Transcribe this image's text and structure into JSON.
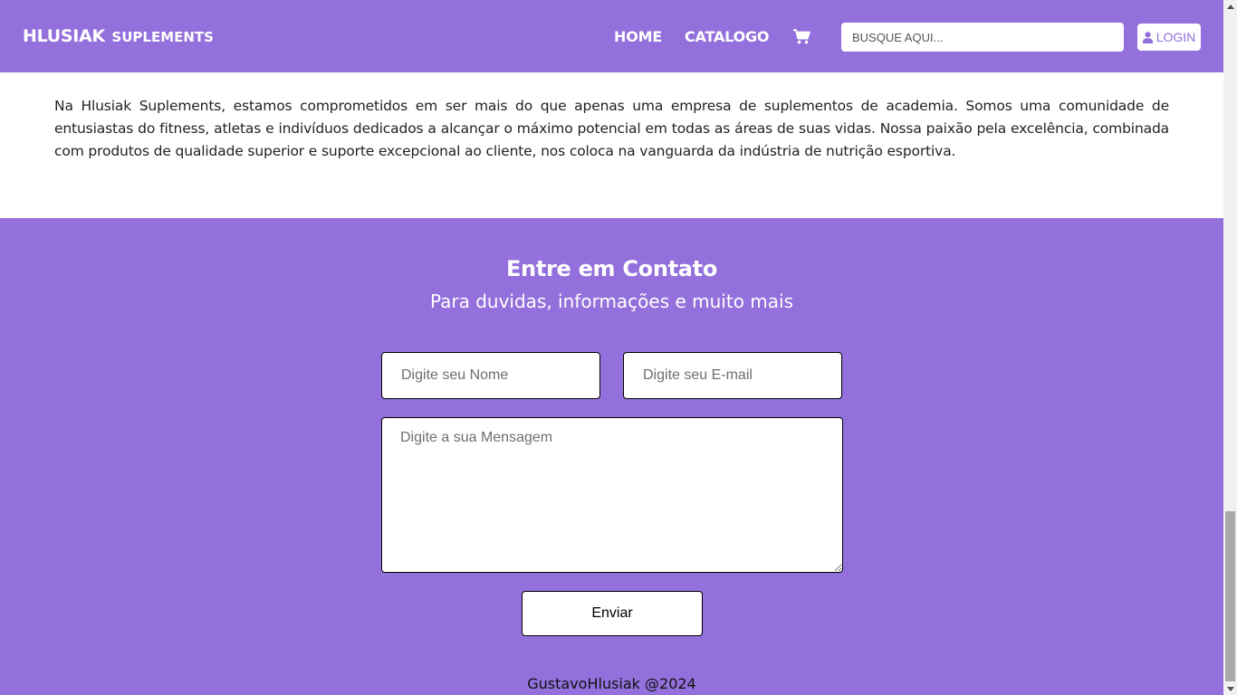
{
  "brand": {
    "main": "HLUSIAK",
    "sub": "SUPLEMENTS"
  },
  "nav": {
    "home": "HOME",
    "catalogo": "CATALOGO",
    "cart_icon": "cart-icon"
  },
  "search": {
    "placeholder": "BUSQUE AQUI...",
    "value": ""
  },
  "login": {
    "label": "LOGIN",
    "icon": "user-icon"
  },
  "about": {
    "text": "Na Hlusiak Suplements, estamos comprometidos em ser mais do que apenas uma empresa de suplementos de academia. Somos uma comunidade de entusiastas do fitness, atletas e indivíduos dedicados a alcançar o máximo potencial em todas as áreas de suas vidas. Nossa paixão pela excelência, combinada com produtos de qualidade superior e suporte excepcional ao cliente, nos coloca na vanguarda da indústria de nutrição esportiva."
  },
  "contact": {
    "title": "Entre em Contato",
    "subtitle": "Para duvidas, informações e muito mais",
    "name_placeholder": "Digite seu Nome",
    "email_placeholder": "Digite seu E-mail",
    "message_placeholder": "Digite a sua Mensagem",
    "send_label": "Enviar"
  },
  "footer": {
    "text": "GustavoHlusiak @2024"
  },
  "colors": {
    "primary": "#9370db",
    "white": "#ffffff",
    "text": "#222222"
  }
}
